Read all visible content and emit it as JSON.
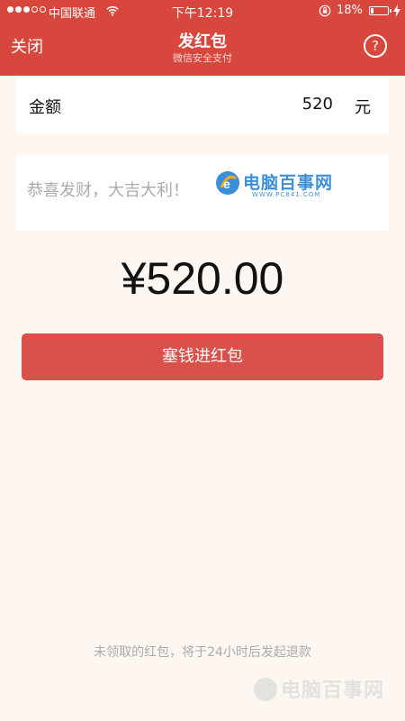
{
  "status_bar": {
    "carrier": "中国联通",
    "time": "下午12:19",
    "battery_percent": "18%",
    "battery_level": 0.18,
    "signal_bars_filled": 3,
    "signal_bars_total": 5
  },
  "nav": {
    "close_label": "关闭",
    "title": "发红包",
    "subtitle": "微信安全支付",
    "help_label": "?"
  },
  "amount_field": {
    "label": "金额",
    "value": "520",
    "unit": "元"
  },
  "greeting_field": {
    "placeholder": "恭喜发财，大吉大利！"
  },
  "total_display": "¥520.00",
  "send_button_label": "塞钱进红包",
  "footer_note": "未领取的红包，将于24小时后发起退款",
  "watermark": {
    "brand_text": "电脑百事网",
    "url_text": "WWW.PC841.COM"
  },
  "colors": {
    "header_red": "#d8473d",
    "button_red": "#d9514a",
    "background": "#fdf6f1",
    "watermark_blue": "#3b8fd8"
  },
  "icons": [
    "wifi-icon",
    "rotation-lock-icon",
    "battery-icon",
    "charging-bolt-icon",
    "help-icon"
  ]
}
